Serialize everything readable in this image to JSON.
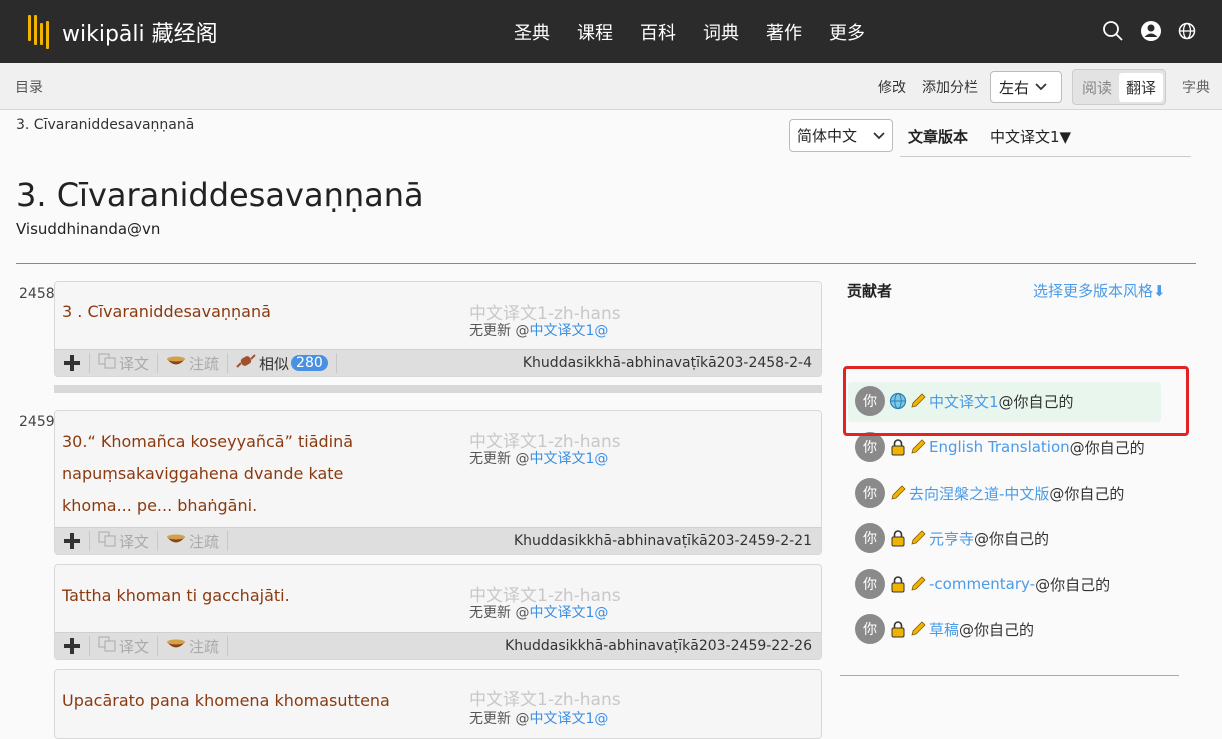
{
  "app": {
    "logo_text": "wikipāli 藏经阁",
    "nav": [
      "圣典",
      "课程",
      "百科",
      "词典",
      "著作",
      "更多"
    ]
  },
  "toolbar": {
    "toc": "目录",
    "edit": "修改",
    "add_column": "添加分栏",
    "layout_value": "左右",
    "mode_read": "阅读",
    "mode_translate": "翻译",
    "dict": "字典"
  },
  "header": {
    "breadcrumb": "3. Cīvaraniddesavaṇṇanā",
    "language_select": "简体中文",
    "version_label": "文章版本",
    "version_value": "中文译文1▼",
    "title": "3. Cīvaraniddesavaṇṇanā",
    "author": "Visuddhinanda@vn"
  },
  "sentences": [
    {
      "para": "2458",
      "pali": "3 . Cīvaraniddesavaṇṇanā",
      "tr_title": "中文译文1-zh-hans",
      "tr_status": "无更新 @",
      "tr_link": "中文译文1@",
      "btn_add": "",
      "btn_translate": "译文",
      "btn_note": "注疏",
      "btn_similar": "相似",
      "similar_count": "280",
      "ref": "Khuddasikkhā-abhinavaṭīkā203-2458-2-4"
    },
    {
      "para": "2459",
      "pali": "30.“ Khomañca koseyyañcā” tiādinā napuṃsakaviggahena dvande kate khoma... pe... bhaṅgāni.",
      "tr_title": "中文译文1-zh-hans",
      "tr_status": "无更新 @",
      "tr_link": "中文译文1@",
      "btn_translate": "译文",
      "btn_note": "注疏",
      "ref": "Khuddasikkhā-abhinavaṭīkā203-2459-2-21"
    },
    {
      "para": "",
      "pali": "Tattha khoman ti gacchajāti.",
      "tr_title": "中文译文1-zh-hans",
      "tr_status": "无更新 @",
      "tr_link": "中文译文1@",
      "btn_translate": "译文",
      "btn_note": "注疏",
      "ref": "Khuddasikkhā-abhinavaṭīkā203-2459-22-26"
    },
    {
      "para": "",
      "pali": "Upacārato pana khomena khomasuttena",
      "tr_title": "中文译文1-zh-hans",
      "tr_status": "无更新 @",
      "tr_link": "中文译文1@"
    }
  ],
  "panel": {
    "title": "贡献者",
    "more_styles": "选择更多版本风格⬇",
    "contributors": [
      {
        "avatar": "你",
        "name": "中文译文1",
        "suffix": "@你自己的",
        "icon": "globe"
      },
      {
        "avatar": "你",
        "name": "English Translation",
        "suffix": "@你自己的",
        "icon": "lock"
      },
      {
        "avatar": "你",
        "name": "去向涅槃之道-中文版",
        "suffix": "@你自己的",
        "icon": "none"
      },
      {
        "avatar": "你",
        "name": "元亨寺",
        "suffix": "@你自己的",
        "icon": "lock"
      },
      {
        "avatar": "你",
        "name": "-commentary-",
        "suffix": "@你自己的",
        "icon": "lock"
      },
      {
        "avatar": "你",
        "name": "草稿",
        "suffix": "@你自己的",
        "icon": "lock"
      }
    ]
  },
  "colors": {
    "topbar": "#2b2b2b",
    "logo_accent": "#f2b400",
    "pali_text": "#8b3a10",
    "link": "#4a9be8",
    "highlight": "#e02424"
  }
}
